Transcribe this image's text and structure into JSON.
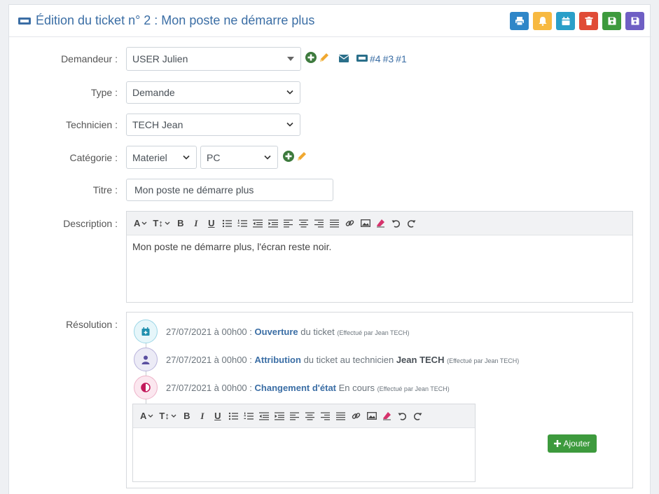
{
  "header": {
    "title": "Édition du ticket n° 2 : Mon poste ne démarre plus",
    "actions": [
      {
        "name": "print-button",
        "icon": "print-icon",
        "color": "#2f86c8"
      },
      {
        "name": "notify-button",
        "icon": "bell-icon",
        "color": "#f7b941"
      },
      {
        "name": "calendar-button",
        "icon": "calendar-icon",
        "color": "#2a9fc9"
      },
      {
        "name": "delete-button",
        "icon": "trash-icon",
        "color": "#e04b36"
      },
      {
        "name": "save-button",
        "icon": "save-icon",
        "color": "#3d9a3d"
      },
      {
        "name": "save-close-button",
        "icon": "save-icon",
        "color": "#6f5fc4"
      }
    ]
  },
  "form": {
    "requester": {
      "label": "Demandeur :",
      "value": "USER Julien",
      "tickets": [
        "#4",
        "#3",
        "#1"
      ]
    },
    "type": {
      "label": "Type :",
      "value": "Demande"
    },
    "technician": {
      "label": "Technicien :",
      "value": "TECH Jean"
    },
    "category": {
      "label": "Catégorie :",
      "value": "Materiel",
      "subvalue": "PC"
    },
    "title": {
      "label": "Titre :",
      "value": "Mon poste ne démarre plus"
    },
    "description": {
      "label": "Description :",
      "text": "Mon poste ne démarre plus, l'écran reste noir."
    },
    "resolution": {
      "label": "Résolution :"
    }
  },
  "timeline": [
    {
      "date": "27/07/2021 à 00h00 :",
      "event": "Ouverture",
      "rest": "du ticket",
      "tech": "",
      "by": "(Effectué par Jean TECH)",
      "icon": "calendar-plus-icon",
      "color": "#2aa8c9",
      "bg": "#e6f6fa"
    },
    {
      "date": "27/07/2021 à 00h00 :",
      "event": "Attribution",
      "rest": "du ticket au technicien",
      "tech": "Jean TECH",
      "by": "(Effectué par Jean TECH)",
      "icon": "user-icon",
      "color": "#5a4fa0",
      "bg": "#ecebf6"
    },
    {
      "date": "27/07/2021 à 00h00 :",
      "event": "Changement d'état",
      "rest": "En cours",
      "tech": "",
      "by": "(Effectué par Jean TECH)",
      "icon": "half-circle-icon",
      "color": "#c2185b",
      "bg": "#fbe7ef"
    }
  ],
  "add_button": "Ajouter",
  "colors": {
    "accent": "#3b6ea5",
    "success": "#3d9a3d",
    "warning": "#f0a830"
  }
}
